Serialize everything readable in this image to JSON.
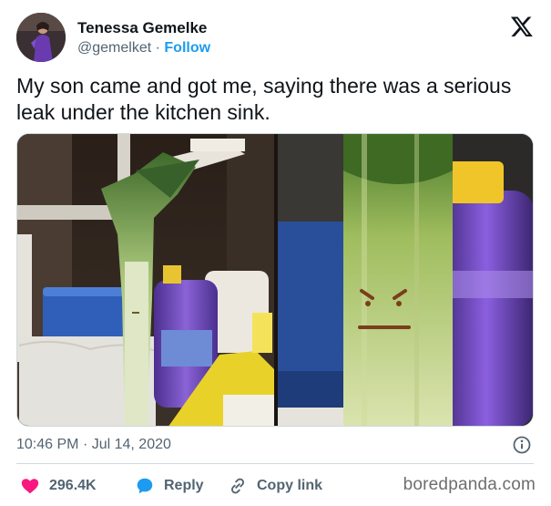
{
  "author": {
    "display_name": "Tenessa Gemelke",
    "handle": "@gemelket",
    "separator": "·",
    "follow_label": "Follow"
  },
  "platform_icon": "x-logo-icon",
  "tweet": {
    "text": "My son came and got me, saying there was a serious leak under the kitchen sink."
  },
  "media": [
    {
      "icon": "photo-leek-under-sink"
    },
    {
      "icon": "photo-leek-closeup-face"
    }
  ],
  "meta": {
    "time": "10:46 PM",
    "separator": "·",
    "date": "Jul 14, 2020",
    "info_icon": "info-icon"
  },
  "actions": {
    "like_count": "296.4K",
    "reply_label": "Reply",
    "copy_link_label": "Copy link"
  },
  "watermark": "boredpanda.com",
  "colors": {
    "text": "#0f1419",
    "secondary": "#536471",
    "accent_blue": "#1d9bf0",
    "like_red": "#f91880",
    "border": "#cfd9de"
  }
}
